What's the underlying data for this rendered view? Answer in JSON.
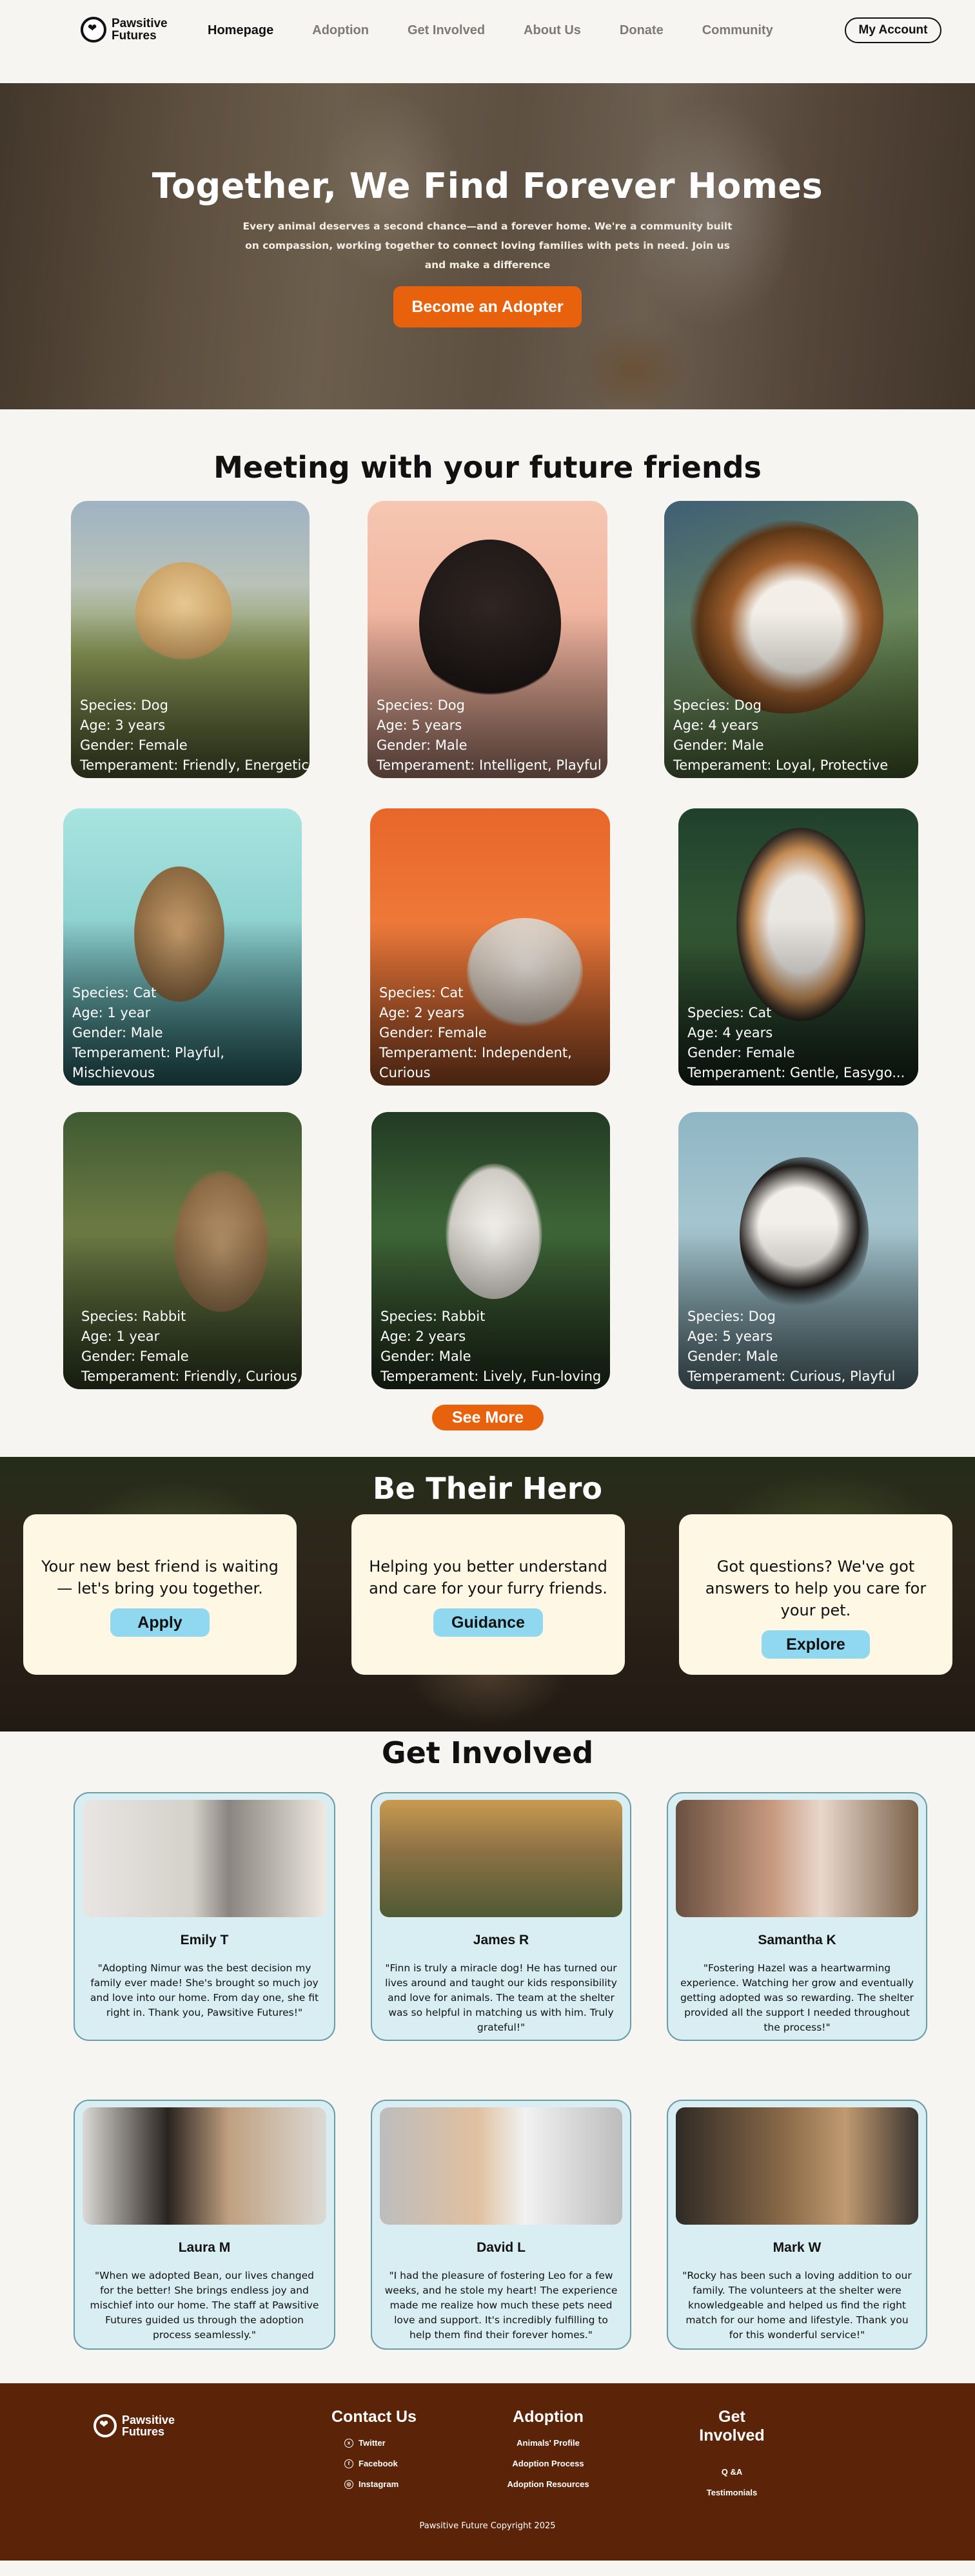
{
  "brand": {
    "line1": "Pawsitive",
    "line2": "Futures"
  },
  "nav": {
    "links": [
      "Homepage",
      "Adoption",
      "Get Involved",
      "About Us",
      "Donate",
      "Community"
    ],
    "account": "My Account"
  },
  "hero": {
    "title": "Together, We Find Forever Homes",
    "text": "Every animal deserves a second chance—and a forever home. We're a community built on compassion, working together to connect loving families with pets in need. Join us and make a difference",
    "button": "Become an Adopter"
  },
  "friends": {
    "title": "Meeting with your future friends",
    "pets": [
      {
        "lines": [
          "Species: Dog",
          "Age: 3 years",
          "Gender: Female",
          "Temperament: Friendly, Energetic"
        ]
      },
      {
        "lines": [
          "Species: Dog",
          "Age: 5 years",
          "Gender: Male",
          "Temperament: Intelligent, Playful"
        ]
      },
      {
        "lines": [
          "Species: Dog",
          "Age: 4 years",
          "Gender: Male",
          "Temperament: Loyal, Protective"
        ]
      },
      {
        "lines": [
          "Species: Cat",
          "Age: 1 year",
          "Gender: Male",
          "Temperament: Playful, Mischievous"
        ]
      },
      {
        "lines": [
          "Species: Cat",
          "Age: 2 years",
          "Gender: Female",
          "Temperament: Independent, Curious"
        ]
      },
      {
        "lines": [
          "Species: Cat",
          "Age: 4 years",
          "Gender: Female",
          "Temperament: Gentle, Easygo..."
        ]
      },
      {
        "lines": [
          "Species: Rabbit",
          "Age: 1 year",
          "Gender: Female",
          "Temperament: Friendly, Curious"
        ]
      },
      {
        "lines": [
          "Species: Rabbit",
          "Age: 2 years",
          "Gender: Male",
          "Temperament: Lively, Fun-loving"
        ]
      },
      {
        "lines": [
          "Species: Dog",
          "Age: 5 years",
          "Gender: Male",
          "Temperament: Curious, Playful"
        ]
      }
    ],
    "see_more": "See More"
  },
  "hero_section": {
    "title": "Be Their Hero",
    "cards": [
      {
        "text": "Your new best friend is waiting — let's bring you together.",
        "button": "Apply"
      },
      {
        "text": "Helping you better understand and care for your furry friends.",
        "button": "Guidance"
      },
      {
        "text": "Got questions? We've got answers to help you care for your pet.",
        "button": "Explore"
      }
    ]
  },
  "involved": {
    "title": "Get Involved",
    "testimonials": [
      {
        "name": "Emily T",
        "quote": "\"Adopting Nimur was the best decision my family ever made! She's brought so much joy and love into our home. From day one, she fit right in. Thank you, Pawsitive Futures!\""
      },
      {
        "name": "James R",
        "quote": "\"Finn is truly a miracle dog! He has turned our lives around and taught our kids responsibility and love for animals. The team at the shelter was so helpful in matching us with him. Truly grateful!\""
      },
      {
        "name": "Samantha K",
        "quote": "\"Fostering Hazel was a heartwarming experience. Watching her grow and eventually getting adopted was so rewarding. The shelter provided all the support I needed throughout the process!\""
      },
      {
        "name": "Laura M",
        "quote": "\"When we adopted Bean, our lives changed for the better! She brings endless joy and mischief into our home. The staff at Pawsitive Futures guided us through the adoption process seamlessly.\""
      },
      {
        "name": "David L",
        "quote": "\"I had the pleasure of fostering Leo for a few weeks, and he stole my heart! The experience made me realize how much these pets need love and support. It's incredibly fulfilling to help them find their forever homes.\""
      },
      {
        "name": "Mark W",
        "quote": "\"Rocky has been such a loving addition to our family. The volunteers at the shelter were knowledgeable and helped us find the right match for our home and lifestyle. Thank you for this wonderful service!\""
      }
    ]
  },
  "footer": {
    "contact": {
      "title": "Contact Us",
      "links": [
        "Twitter",
        "Facebook",
        "Instagram"
      ]
    },
    "adoption": {
      "title": "Adoption",
      "links": [
        "Animals' Profile",
        "Adoption Process",
        "Adoption Resources"
      ]
    },
    "involved": {
      "title": "Get Involved",
      "links": [
        "Q &A",
        "Testimonials"
      ]
    },
    "copyright": "Pawsitive Future Copyright 2025"
  }
}
